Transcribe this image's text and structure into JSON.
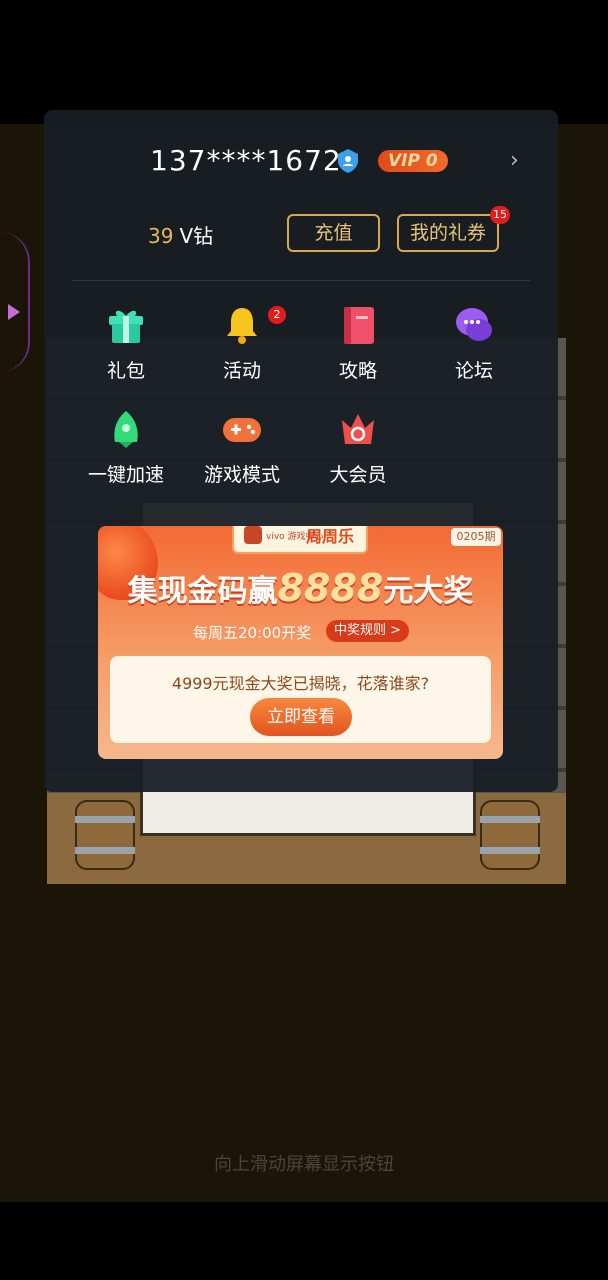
{
  "account": {
    "phone": "137****1672",
    "vip_label": "VIP",
    "vip_level": "0"
  },
  "wallet": {
    "amount": "39",
    "unit": "V钻"
  },
  "actions": {
    "recharge": "充值",
    "my_gifts": "我的礼券",
    "gifts_badge": "15"
  },
  "menu": [
    {
      "label": "礼包",
      "icon": "gift-icon"
    },
    {
      "label": "活动",
      "icon": "bell-icon",
      "badge": "2"
    },
    {
      "label": "攻略",
      "icon": "book-icon"
    },
    {
      "label": "论坛",
      "icon": "chat-bubbles-icon"
    },
    {
      "label": "一键加速",
      "icon": "rocket-icon"
    },
    {
      "label": "游戏模式",
      "icon": "gamepad-icon"
    },
    {
      "label": "大会员",
      "icon": "crown-icon"
    }
  ],
  "promo": {
    "brand": "周周乐",
    "brand_sub": "vivo 游戏中心",
    "period": "0205期",
    "title_pre": "集现金码赢",
    "title_amount": "8888",
    "title_post": "元大奖",
    "schedule": "每周五20:00开奖",
    "rules": "中奖规则 >",
    "message": "4999元现金大奖已揭晓，花落谁家?",
    "cta": "立即查看"
  },
  "hint": "向上滑动屏幕显示按钮",
  "colors": {
    "accent_gold": "#d9a84e",
    "vip_red": "#e04a1a",
    "badge_red": "#e21c1c",
    "panel": "#181e24"
  }
}
